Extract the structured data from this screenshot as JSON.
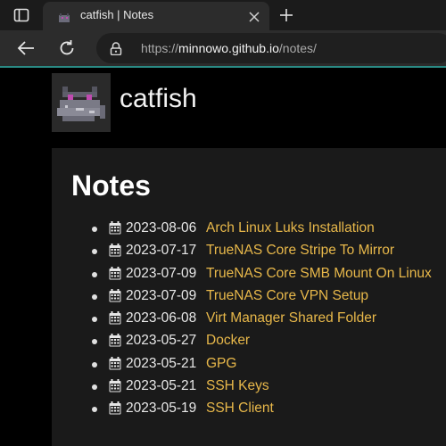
{
  "browser": {
    "tab_title": "catfish | Notes",
    "url_scheme": "https://",
    "url_host": "minnowo.github.io",
    "url_path": "/notes/"
  },
  "site": {
    "title": "catfish"
  },
  "main": {
    "heading": "Notes",
    "notes": [
      {
        "date": "2023-08-06",
        "title": "Arch Linux Luks Installation"
      },
      {
        "date": "2023-07-17",
        "title": "TrueNAS Core Stripe To Mirror"
      },
      {
        "date": "2023-07-09",
        "title": "TrueNAS Core SMB Mount On Linux"
      },
      {
        "date": "2023-07-09",
        "title": "TrueNAS Core VPN Setup"
      },
      {
        "date": "2023-06-08",
        "title": "Virt Manager Shared Folder"
      },
      {
        "date": "2023-05-27",
        "title": "Docker"
      },
      {
        "date": "2023-05-21",
        "title": "GPG"
      },
      {
        "date": "2023-05-21",
        "title": "SSH Keys"
      },
      {
        "date": "2023-05-19",
        "title": "SSH Client"
      }
    ]
  },
  "colors": {
    "link": "#e8b84a",
    "accent": "#2a8a84"
  },
  "icons": {
    "note_icon": "calendar-icon",
    "logo": "pixel-cat-fish-logo"
  }
}
